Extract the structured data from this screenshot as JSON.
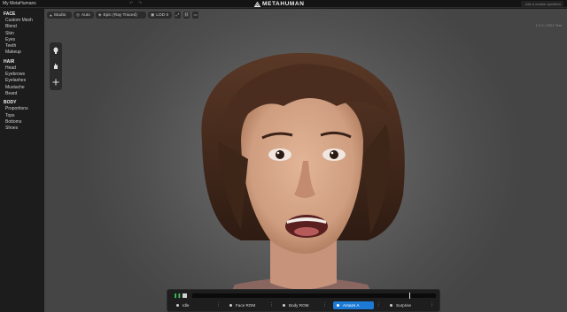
{
  "topbar": {
    "breadcrumb": "My MetaHumans",
    "brand": "METAHUMAN",
    "assistant_placeholder": "Ask a creator question"
  },
  "sidebar": {
    "sections": [
      {
        "title": "FACE",
        "items": [
          "Custom Mesh",
          "Blend",
          "Skin",
          "Eyes",
          "Teeth",
          "Makeup"
        ]
      },
      {
        "title": "HAIR",
        "items": [
          "Head",
          "Eyebrows",
          "Eyelashes",
          "Mustache",
          "Beard"
        ]
      },
      {
        "title": "BODY",
        "items": [
          "Proportions",
          "Tops",
          "Bottoms",
          "Shoes"
        ]
      }
    ]
  },
  "viewport_toolbar": {
    "studio": "Studio",
    "auto": "Auto",
    "quality": "Epic (Ray Traced)",
    "lod": "LOD 0"
  },
  "viewport": {
    "version": "1.2.3 | 2021 Test"
  },
  "animation": {
    "clips": [
      {
        "label": "Idle",
        "selected": false
      },
      {
        "label": "Face ROM",
        "selected": false
      },
      {
        "label": "Body ROM",
        "selected": false
      },
      {
        "label": "Amaze A",
        "selected": true
      },
      {
        "label": "Surprise",
        "selected": false
      }
    ],
    "playback_progress": 0.89
  },
  "colors": {
    "accent": "#1c7ad6",
    "play": "#3fd25f",
    "panel": "#1c1c1c"
  }
}
